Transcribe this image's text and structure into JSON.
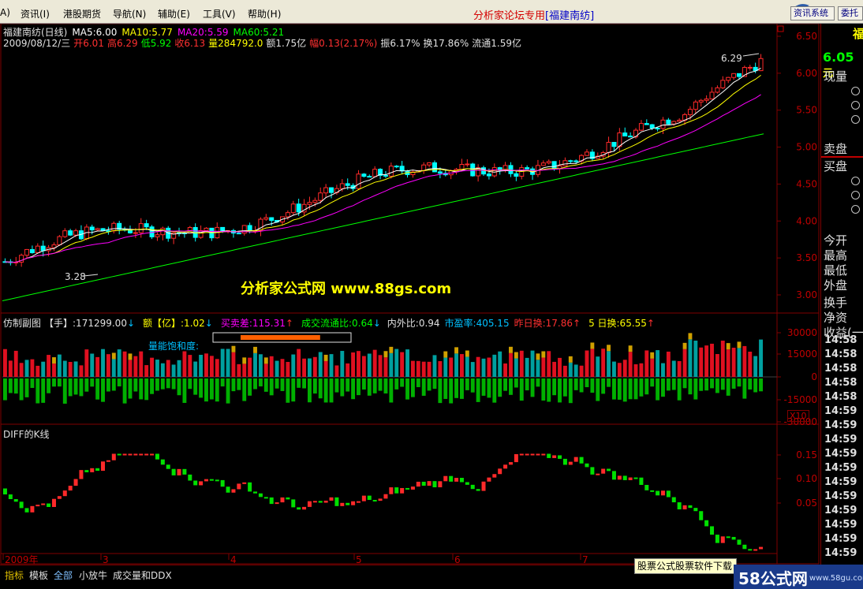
{
  "menu": {
    "items": [
      "A)",
      "资讯(I)",
      "港股期货",
      "导航(N)",
      "辅助(E)",
      "工具(V)",
      "帮助(H)"
    ],
    "forum": "分析家论坛专用",
    "stock_tag": "[福建南纺]",
    "buttons": [
      "资讯系统",
      "委托"
    ]
  },
  "header": {
    "line1": {
      "name": "福建南纺(日线)",
      "ma5": "MA5:6.00",
      "ma10": "MA10:5.77",
      "ma20": "MA20:5.59",
      "ma60": "MA60:5.21"
    },
    "line2": {
      "date": "2009/08/12/三",
      "open": "开6.01",
      "high": "高6.29",
      "low": "低5.92",
      "close": "收6.13",
      "vol": "量284792.0",
      "amount": "额1.75亿",
      "change": "幅0.13(2.17%)",
      "amplitude": "振6.17%",
      "turnover": "换17.86%",
      "float": "流通1.59亿"
    }
  },
  "colors": {
    "up": "#ff2a2a",
    "down": "#00ffff",
    "ma5": "#ffffff",
    "ma10": "#ffff00",
    "ma20": "#ff00ff",
    "ma60": "#00ff00",
    "frame": "#800000"
  },
  "main_chart": {
    "price_ticks": [
      "6.50",
      "6.00",
      "5.50",
      "5.00",
      "4.50",
      "4.00",
      "3.50",
      "3.00"
    ],
    "high_label": "6.29",
    "low_label": "3.28",
    "watermark": "分析家公式网 www.88gs.com"
  },
  "sub1": {
    "title": "仿制副图",
    "hand": "【手】:171299.00",
    "amount": "额【亿】:1.02",
    "bsdiff": "买卖差:115.31",
    "flow_ratio": "成交流通比:0.64",
    "inout": "内外比:0.94",
    "pe": "市盈率:405.15",
    "yturn": "昨日换:17.86",
    "turn5": "5 日换:65.55",
    "saturation_label": "量能饱和度:",
    "saturation_fill": 0.72,
    "ticks": [
      "30000",
      "15000",
      "0",
      "-15000",
      "-30000"
    ],
    "unit": "X10"
  },
  "sub2": {
    "title": "DIFF的K线",
    "ticks": [
      "0.15",
      "0.10",
      "0.05"
    ]
  },
  "xaxis": {
    "labels": [
      "2009年",
      "3",
      "4",
      "5",
      "6",
      "7"
    ]
  },
  "right_panel": {
    "top_char": "福",
    "price": "6.05",
    "unit": "元",
    "labels": [
      "现量",
      "卖盘",
      "买盘",
      "今开",
      "最高",
      "最低",
      "外盘",
      "换手",
      "净资",
      "收益(一"
    ],
    "times": [
      "14:58",
      "14:58",
      "14:58",
      "14:58",
      "14:58",
      "14:59",
      "14:59",
      "14:59",
      "14:59",
      "14:59",
      "14:59",
      "14:59",
      "14:59",
      "14:59",
      "14:59",
      "14:59"
    ]
  },
  "tabs": [
    "指标",
    "模板",
    "全部",
    "小放牛",
    "成交量和DDX"
  ],
  "ad": "股票公式股票软件下载",
  "watermark58": {
    "big": "58公式网",
    "small": "www.58gu.com"
  }
}
